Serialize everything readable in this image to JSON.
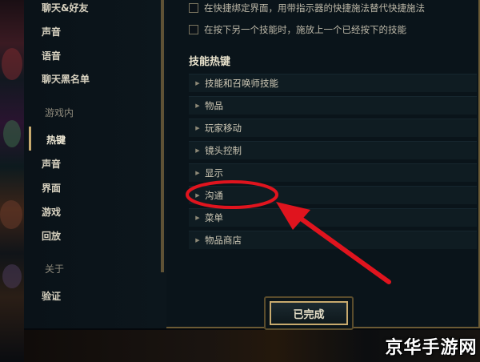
{
  "sidebar": {
    "items": [
      {
        "label": "聊天&好友",
        "kind": "item"
      },
      {
        "label": "声音",
        "kind": "item"
      },
      {
        "label": "语音",
        "kind": "item"
      },
      {
        "label": "聊天黑名单",
        "kind": "item"
      },
      {
        "label": "游戏内",
        "kind": "section"
      },
      {
        "label": "热键",
        "kind": "item",
        "active": true
      },
      {
        "label": "声音",
        "kind": "item"
      },
      {
        "label": "界面",
        "kind": "item"
      },
      {
        "label": "游戏",
        "kind": "item"
      },
      {
        "label": "回放",
        "kind": "item"
      },
      {
        "label": "关于",
        "kind": "section"
      },
      {
        "label": "验证",
        "kind": "item"
      }
    ]
  },
  "options": [
    {
      "label": "在快捷绑定界面，用带指示器的快捷施法替代快捷施法",
      "checked": false
    },
    {
      "label": "在按下另一个技能时，施放上一个已经按下的技能",
      "checked": false
    }
  ],
  "hotkeys": {
    "title": "技能热键",
    "categories": [
      "技能和召唤师技能",
      "物品",
      "玩家移动",
      "镜头控制",
      "显示",
      "沟通",
      "菜单",
      "物品商店"
    ]
  },
  "footer": {
    "done_label": "已完成"
  },
  "watermark": "京华手游网",
  "colors": {
    "accent_gold": "#c8aa6e",
    "annotation_red": "#e0141e"
  }
}
